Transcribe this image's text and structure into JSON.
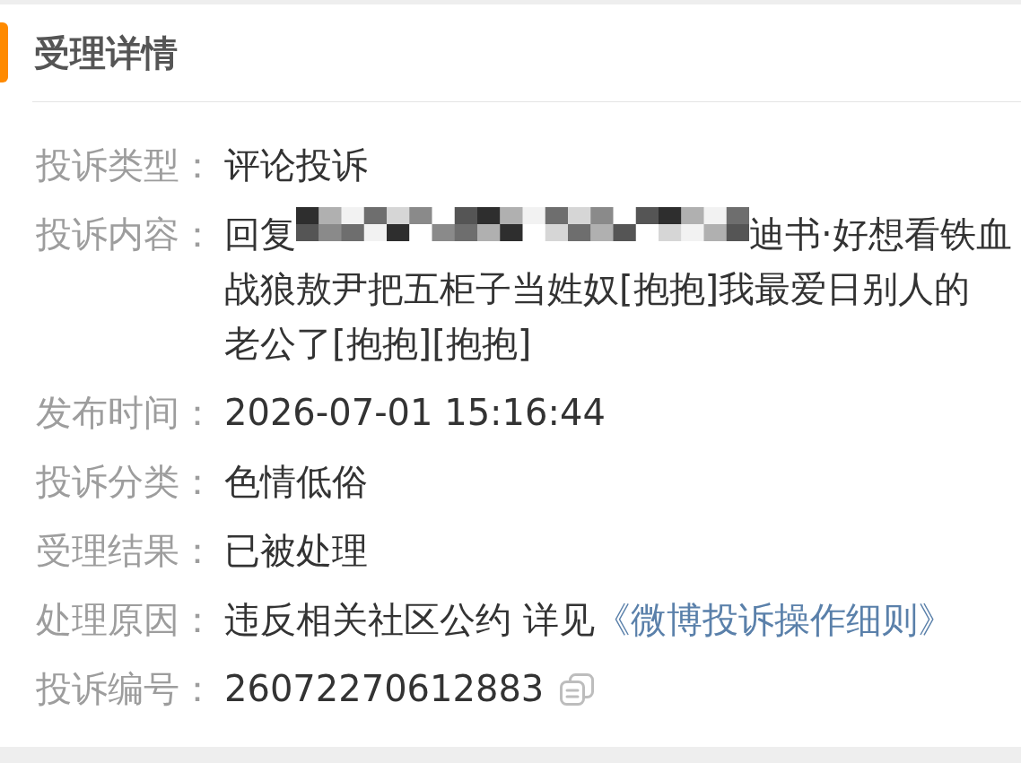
{
  "section": {
    "title": "受理详情"
  },
  "rows": [
    {
      "kind": "text",
      "label": "投诉类型：",
      "value": "评论投诉"
    },
    {
      "kind": "parts",
      "label": "投诉内容：",
      "first_line": [
        {
          "kind": "text",
          "text": "回复"
        },
        {
          "kind": "redacted"
        },
        {
          "kind": "text",
          "text": "迪书·好想看铁血"
        }
      ],
      "rest": "战狼敖尹把五柜子当姓奴[抱抱]我最爱日别人的老公了[抱抱][抱抱]"
    },
    {
      "kind": "text",
      "label": "发布时间：",
      "value": "2026-07-01 15:16:44"
    },
    {
      "kind": "text",
      "label": "投诉分类：",
      "value": "色情低俗"
    },
    {
      "kind": "text",
      "label": "受理结果：",
      "value": "已被处理"
    },
    {
      "kind": "link",
      "label": "处理原因：",
      "value": "违反相关社区公约 详见",
      "link": "《微博投诉操作细则》"
    },
    {
      "kind": "copyable",
      "label": "投诉编号：",
      "value": "26072270612883"
    }
  ]
}
